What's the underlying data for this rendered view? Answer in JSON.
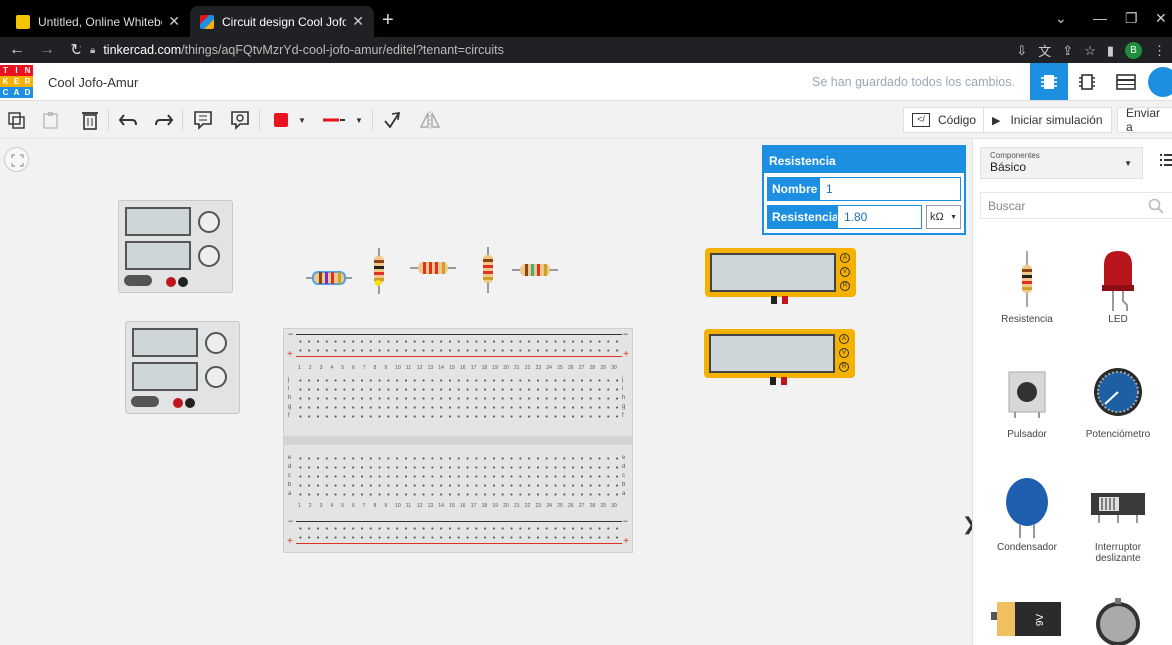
{
  "browser": {
    "tabs": [
      {
        "title": "Untitled, Online Whiteboard for",
        "favicon_color": "#f5c400"
      },
      {
        "title": "Circuit design Cool Jofo-Amur | T",
        "favicon_color": "#1c8fe1"
      }
    ],
    "url_host": "tinkercad.com",
    "url_path": "/things/aqFQtvMzrYd-cool-jofo-amur/editel?tenant=circuits",
    "profile_initial": "B"
  },
  "app": {
    "logo_letters": [
      "T",
      "I",
      "N",
      "K",
      "E",
      "R",
      "C",
      "A",
      "D"
    ],
    "project_name": "Cool Jofo-Amur",
    "save_status": "Se han guardado todos los cambios.",
    "accent": "#1c8fe1"
  },
  "toolbar": {
    "code_label": "Código",
    "simulate_label": "Iniciar simulación",
    "send_label": "Enviar a",
    "wire_color": "#e8131e"
  },
  "props": {
    "title": "Resistencia",
    "name_label": "Nombre",
    "name_value": "1",
    "resistance_label": "Resistencia",
    "resistance_value": "1.80",
    "unit": "kΩ"
  },
  "panel": {
    "category_small": "Componentes",
    "category": "Básico",
    "search_placeholder": "Buscar",
    "items": [
      {
        "label": "Resistencia"
      },
      {
        "label": "LED"
      },
      {
        "label": "Pulsador"
      },
      {
        "label": "Potenciómetro"
      },
      {
        "label": "Condensador"
      },
      {
        "label": "Interruptor deslizante"
      }
    ]
  },
  "breadboard": {
    "column_numbers": [
      "1",
      "2",
      "3",
      "4",
      "5",
      "6",
      "7",
      "8",
      "9",
      "10",
      "11",
      "12",
      "13",
      "14",
      "15",
      "16",
      "17",
      "18",
      "19",
      "20",
      "21",
      "22",
      "23",
      "24",
      "25",
      "26",
      "27",
      "28",
      "29",
      "30"
    ],
    "upper_row_letters": [
      "j",
      "i",
      "h",
      "g",
      "f"
    ],
    "lower_row_letters": [
      "e",
      "d",
      "c",
      "b",
      "a"
    ],
    "rail_minus": "−",
    "rail_plus": "+"
  },
  "meters": {
    "terminals": [
      "A",
      "V",
      "R"
    ]
  },
  "battery": {
    "label": "9V"
  }
}
